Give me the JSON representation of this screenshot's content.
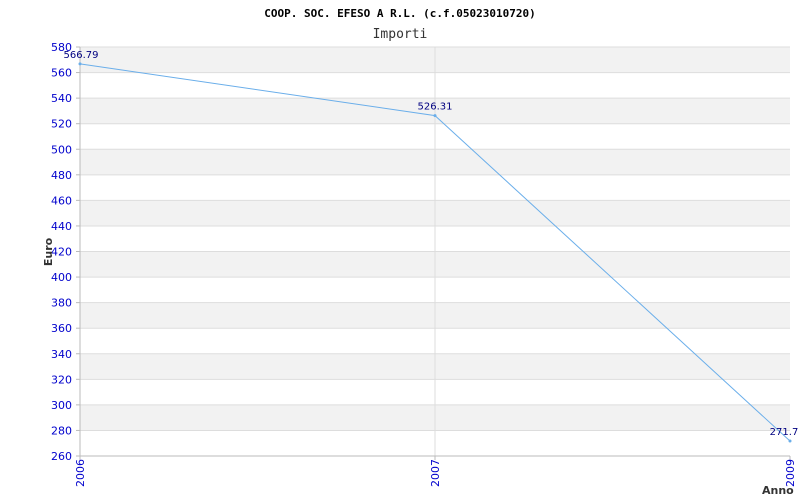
{
  "chart_data": {
    "type": "line",
    "title": "COOP. SOC. EFESO A R.L. (c.f.05023010720)",
    "subtitle": "Importi",
    "xlabel": "Anno",
    "ylabel": "Euro",
    "categories": [
      "2006",
      "2007",
      "2009"
    ],
    "series": [
      {
        "values": [
          566.79,
          526.31,
          271.7
        ]
      }
    ],
    "data_labels": [
      "566.79",
      "526.31",
      "271.7"
    ],
    "ylim": [
      260,
      580
    ],
    "yticks": [
      260,
      280,
      300,
      320,
      340,
      360,
      380,
      400,
      420,
      440,
      460,
      480,
      500,
      520,
      540,
      560,
      580
    ],
    "grid": true,
    "legend": "none",
    "colors": {
      "line": "#6aaeea",
      "tick_text": "#0000cc",
      "data_label": "#000080",
      "band_alt": "#f2f2f2",
      "grid": "#dddddd",
      "axis": "#bbbbbb"
    }
  }
}
